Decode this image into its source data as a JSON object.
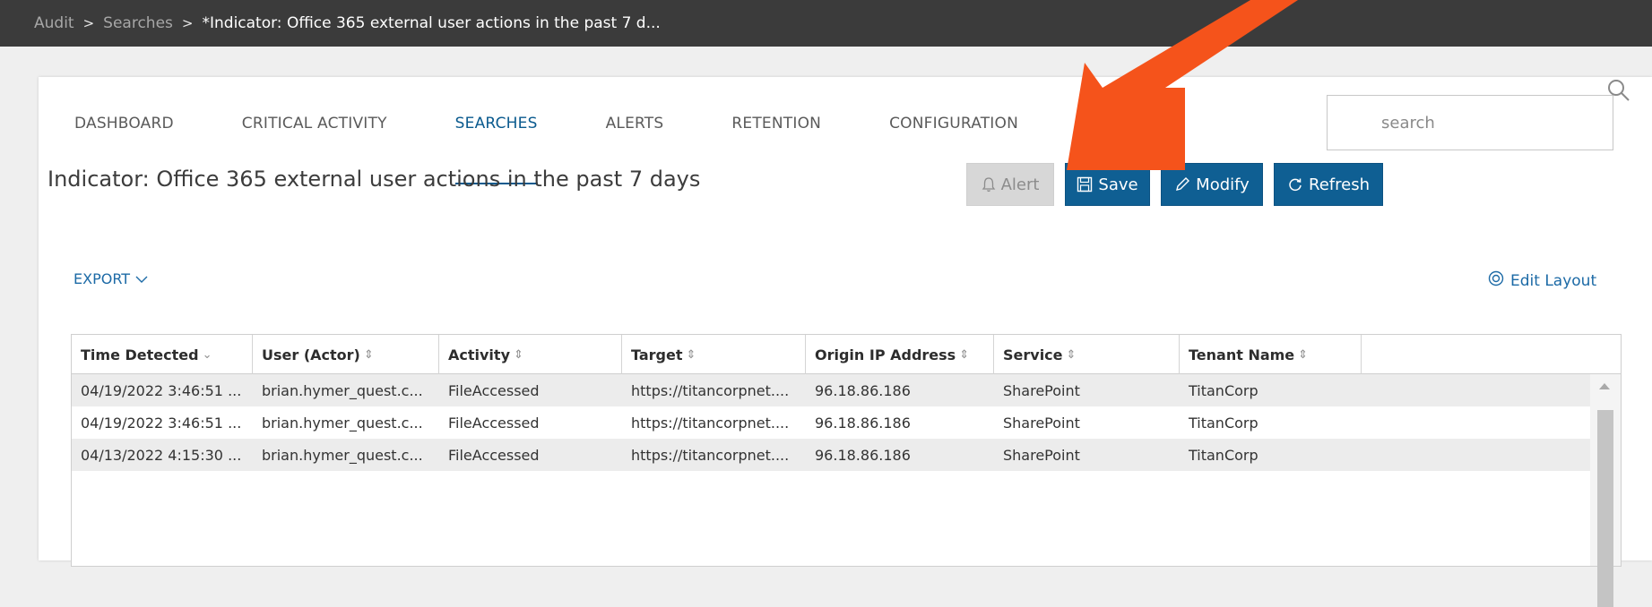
{
  "breadcrumb": {
    "items": [
      "Audit",
      "Searches"
    ],
    "separator": ">",
    "current": "*Indicator: Office 365 external user actions in the past 7 d..."
  },
  "tabs": [
    {
      "label": "DASHBOARD",
      "active": false
    },
    {
      "label": "CRITICAL ACTIVITY",
      "active": false
    },
    {
      "label": "SEARCHES",
      "active": true
    },
    {
      "label": "ALERTS",
      "active": false
    },
    {
      "label": "RETENTION",
      "active": false
    },
    {
      "label": "CONFIGURATION",
      "active": false
    }
  ],
  "search": {
    "placeholder": "search",
    "icon": "magnifier-icon"
  },
  "page_title": "Indicator: Office 365 external user actions in the past 7 days",
  "toolbar": {
    "alert_label": "Alert",
    "save_label": "Save",
    "modify_label": "Modify",
    "refresh_label": "Refresh"
  },
  "export_label": "EXPORT",
  "edit_layout_label": "Edit Layout",
  "table": {
    "columns": [
      "Time Detected",
      "User (Actor)",
      "Activity",
      "Target",
      "Origin IP Address",
      "Service",
      "Tenant Name"
    ],
    "rows": [
      [
        "04/19/2022 3:46:51 ...",
        "brian.hymer_quest.c...",
        "FileAccessed",
        "https://titancorpnet....",
        "96.18.86.186",
        "SharePoint",
        "TitanCorp"
      ],
      [
        "04/19/2022 3:46:51 ...",
        "brian.hymer_quest.c...",
        "FileAccessed",
        "https://titancorpnet....",
        "96.18.86.186",
        "SharePoint",
        "TitanCorp"
      ],
      [
        "04/13/2022 4:15:30 ...",
        "brian.hymer_quest.c...",
        "FileAccessed",
        "https://titancorpnet....",
        "96.18.86.186",
        "SharePoint",
        "TitanCorp"
      ]
    ]
  },
  "colors": {
    "accent": "#0f5f93",
    "link": "#1c6aa6",
    "topbar": "#3b3b3b",
    "arrow": "#f5531b"
  }
}
